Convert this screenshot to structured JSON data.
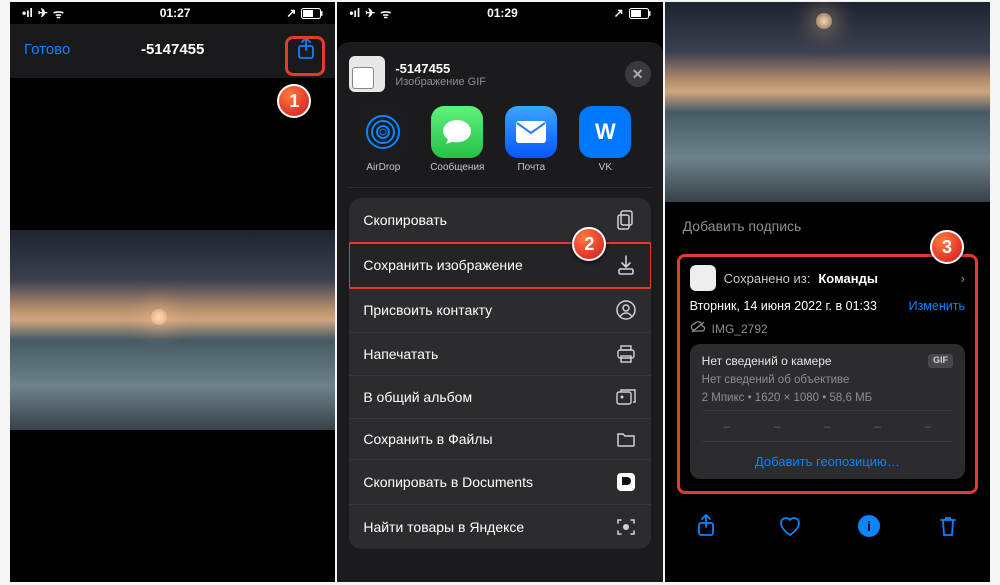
{
  "statusbar": {
    "time1": "01:27",
    "time2": "01:29",
    "carrierGlyph": "•ıl",
    "wifiGlyph": "⟂"
  },
  "phone1": {
    "done": "Готово",
    "title": "-5147455"
  },
  "sheet": {
    "title": "-5147455",
    "subtitle": "Изображение GIF",
    "apps": [
      {
        "name": "AirDrop",
        "kind": "airdrop"
      },
      {
        "name": "Сообщения",
        "kind": "msgs"
      },
      {
        "name": "Почта",
        "kind": "mail"
      },
      {
        "name": "VK",
        "kind": "vk"
      }
    ],
    "actions": [
      {
        "label": "Скопировать",
        "icon": "copy"
      },
      {
        "label": "Сохранить изображение",
        "icon": "download",
        "highlight": true
      },
      {
        "label": "Присвоить контакту",
        "icon": "contact"
      },
      {
        "label": "Напечатать",
        "icon": "print"
      },
      {
        "label": "В общий альбом",
        "icon": "shared"
      },
      {
        "label": "Сохранить в Файлы",
        "icon": "folder"
      },
      {
        "label": "Скопировать в Documents",
        "icon": "docapp"
      },
      {
        "label": "Найти товары в Яндексе",
        "icon": "scan"
      }
    ]
  },
  "detail": {
    "addCaption": "Добавить подпись",
    "savedPrefix": "Сохранено из:",
    "savedApp": "Команды",
    "dateline": "Вторник, 14 июня 2022 г. в 01:33",
    "edit": "Изменить",
    "filename": "IMG_2792",
    "noCamera": "Нет сведений о камере",
    "gifTag": "GIF",
    "noLens": "Нет сведений об объективе",
    "specs": "2 Мпикс  •  1620 × 1080  •  58,6 МБ",
    "addGeo": "Добавить геопозицию…"
  },
  "steps": {
    "s1": "1",
    "s2": "2",
    "s3": "3"
  }
}
